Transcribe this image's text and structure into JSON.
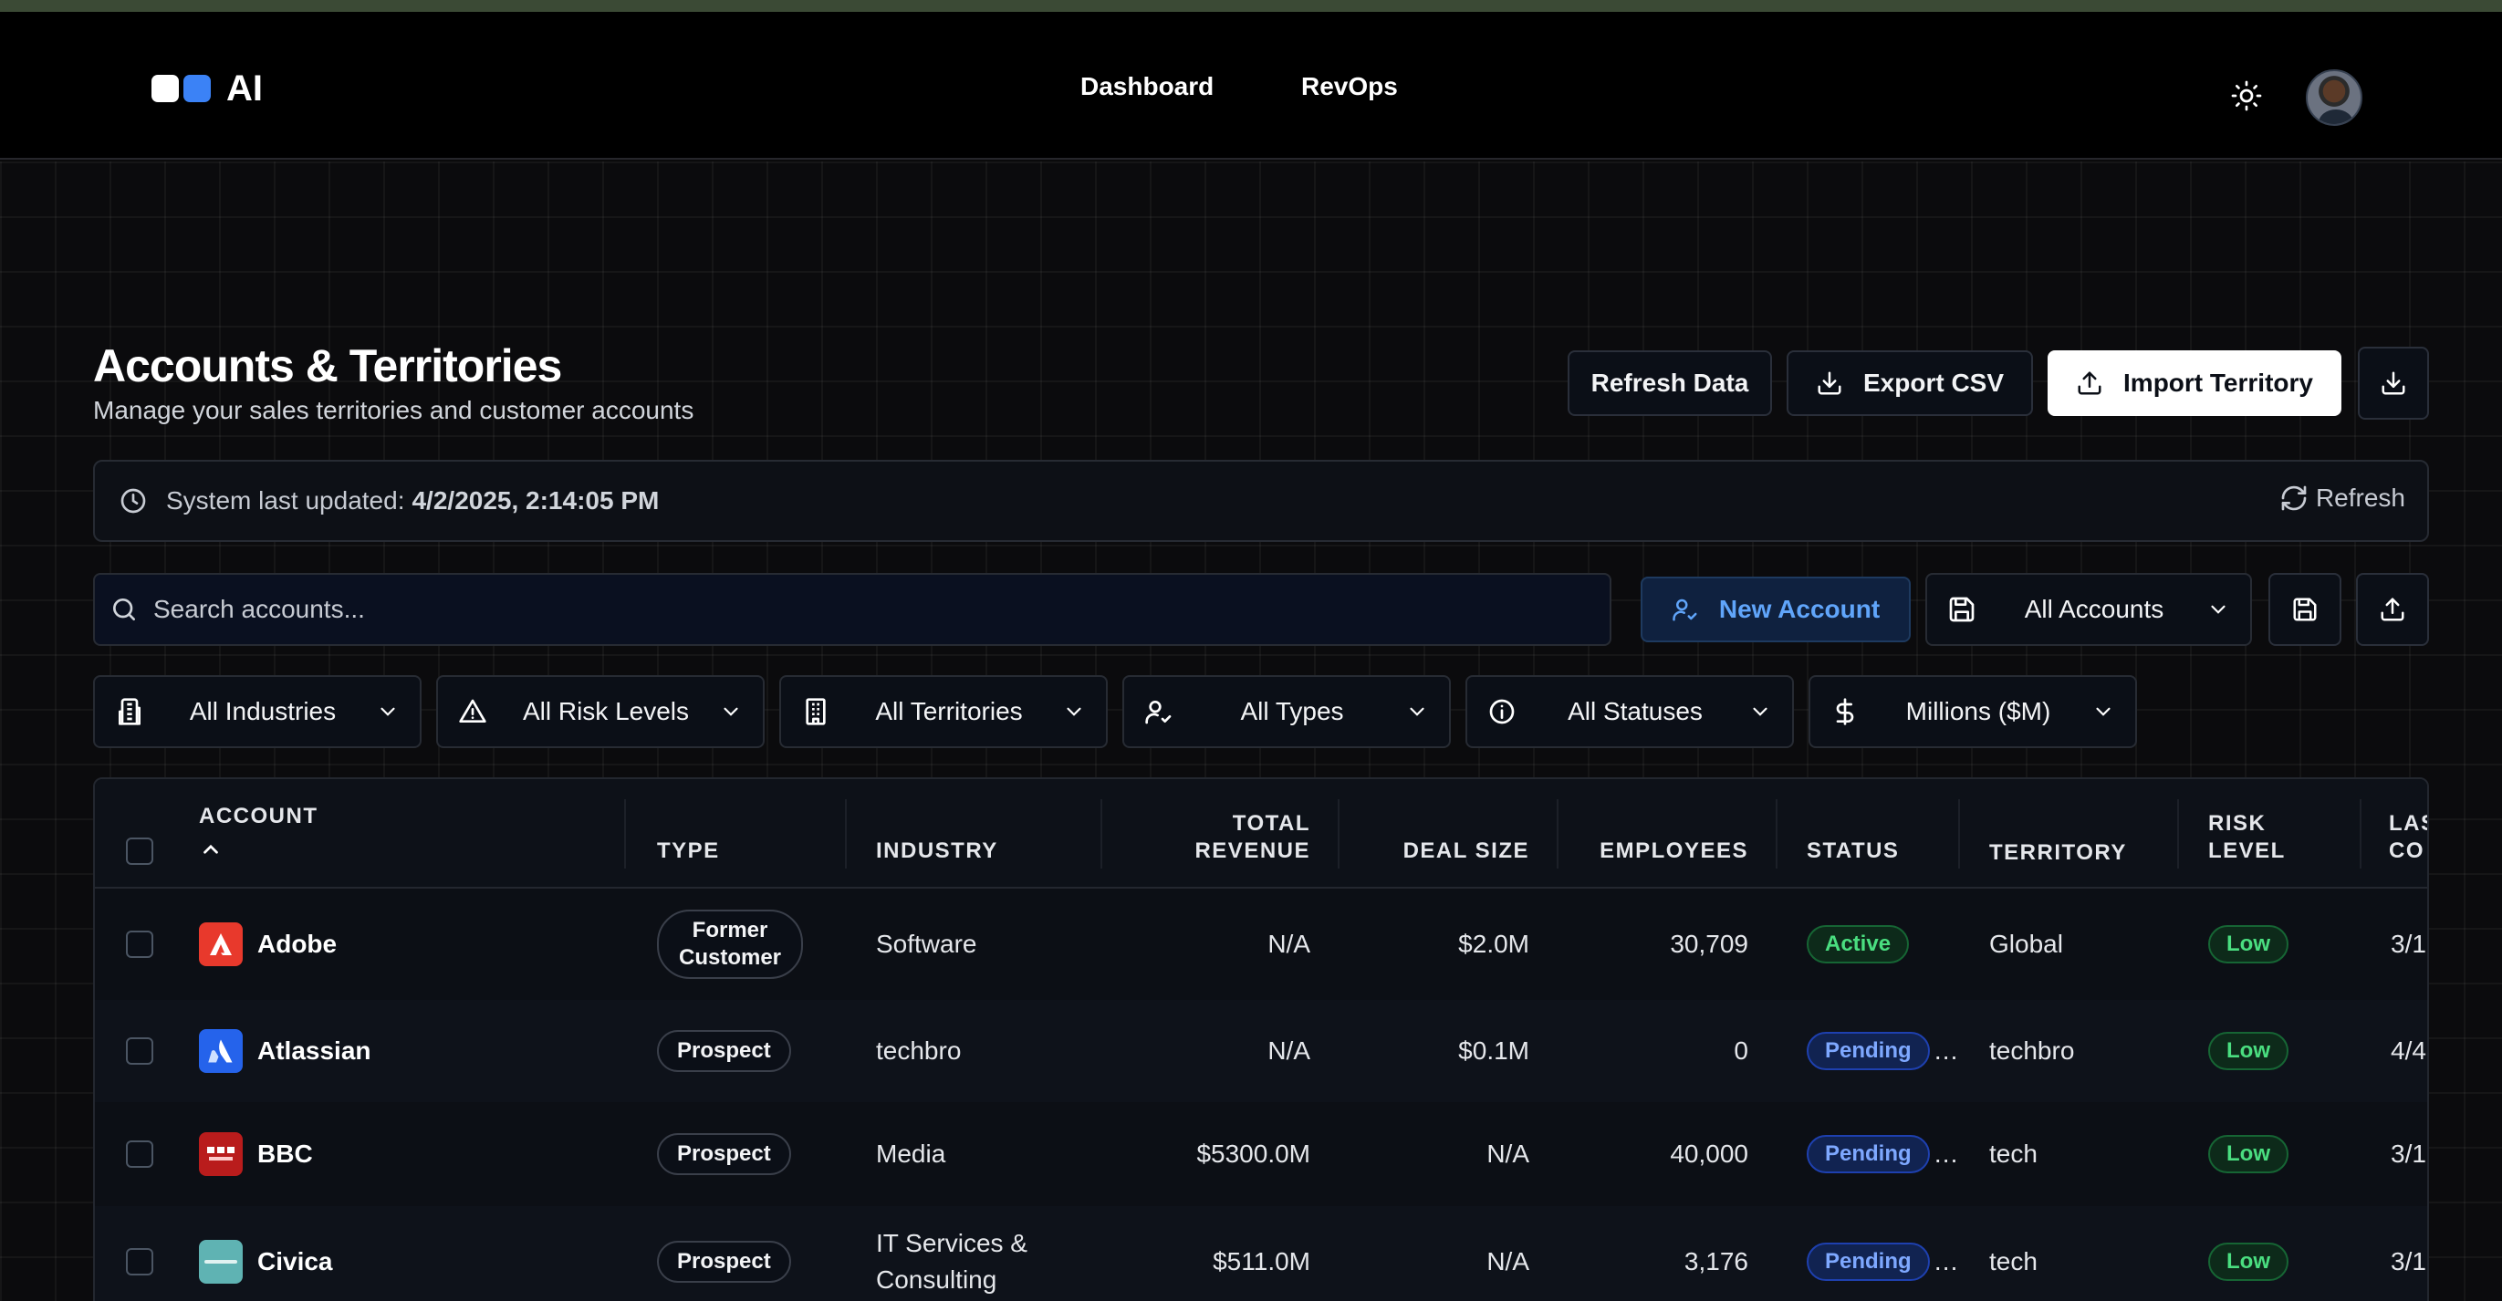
{
  "app": {
    "logo_text": "AI"
  },
  "nav": {
    "links": [
      "Dashboard",
      "RevOps"
    ]
  },
  "page": {
    "title": "Accounts & Territories",
    "subtitle": "Manage your sales territories and customer accounts"
  },
  "actions": {
    "refresh_data": "Refresh Data",
    "export_csv": "Export CSV",
    "import_territory": "Import Territory"
  },
  "status_bar": {
    "label": "System last updated:",
    "timestamp": "4/2/2025, 2:14:05 PM",
    "refresh": "Refresh"
  },
  "search": {
    "placeholder": "Search accounts..."
  },
  "toolbar": {
    "new_account": "New Account",
    "view_select": "All Accounts"
  },
  "filters": {
    "industries": "All Industries",
    "risk_levels": "All Risk Levels",
    "territories": "All Territories",
    "types": "All Types",
    "statuses": "All Statuses",
    "units": "Millions ($M)"
  },
  "table": {
    "columns": {
      "account": "ACCOUNT",
      "type": "TYPE",
      "industry": "INDUSTRY",
      "total_revenue_1": "TOTAL",
      "total_revenue_2": "REVENUE",
      "deal_size": "DEAL SIZE",
      "employees": "EMPLOYEES",
      "status": "STATUS",
      "territory": "TERRITORY",
      "risk_1": "RISK",
      "risk_2": "LEVEL",
      "last_1": "LAS",
      "last_2": "CO"
    },
    "rows": [
      {
        "name": "Adobe",
        "type_1": "Former",
        "type_2": "Customer",
        "industry_1": "Software",
        "industry_2": "",
        "revenue": "N/A",
        "deal": "$2.0M",
        "employees": "30,709",
        "status": "Active",
        "territory": "Global",
        "risk": "Low",
        "last": "3/1",
        "logo_color": "#e8392c",
        "logo_glyph": "A"
      },
      {
        "name": "Atlassian",
        "type_1": "Prospect",
        "type_2": "",
        "industry_1": "techbro",
        "industry_2": "",
        "revenue": "N/A",
        "deal": "$0.1M",
        "employees": "0",
        "status": "Pending",
        "territory": "techbro",
        "risk": "Low",
        "last": "4/4",
        "logo_color": "#2563eb",
        "logo_glyph": "A"
      },
      {
        "name": "BBC",
        "type_1": "Prospect",
        "type_2": "",
        "industry_1": "Media",
        "industry_2": "",
        "revenue": "$5300.0M",
        "deal": "N/A",
        "employees": "40,000",
        "status": "Pending",
        "territory": "tech",
        "risk": "Low",
        "last": "3/1",
        "logo_color": "#b91c1c",
        "logo_glyph": "BBC"
      },
      {
        "name": "Civica",
        "type_1": "Prospect",
        "type_2": "",
        "industry_1": "IT Services &",
        "industry_2": "Consulting",
        "revenue": "$511.0M",
        "deal": "N/A",
        "employees": "3,176",
        "status": "Pending",
        "territory": "tech",
        "risk": "Low",
        "last": "3/1",
        "logo_color": "#5fb3b3",
        "logo_glyph": "CIVICA"
      }
    ]
  }
}
